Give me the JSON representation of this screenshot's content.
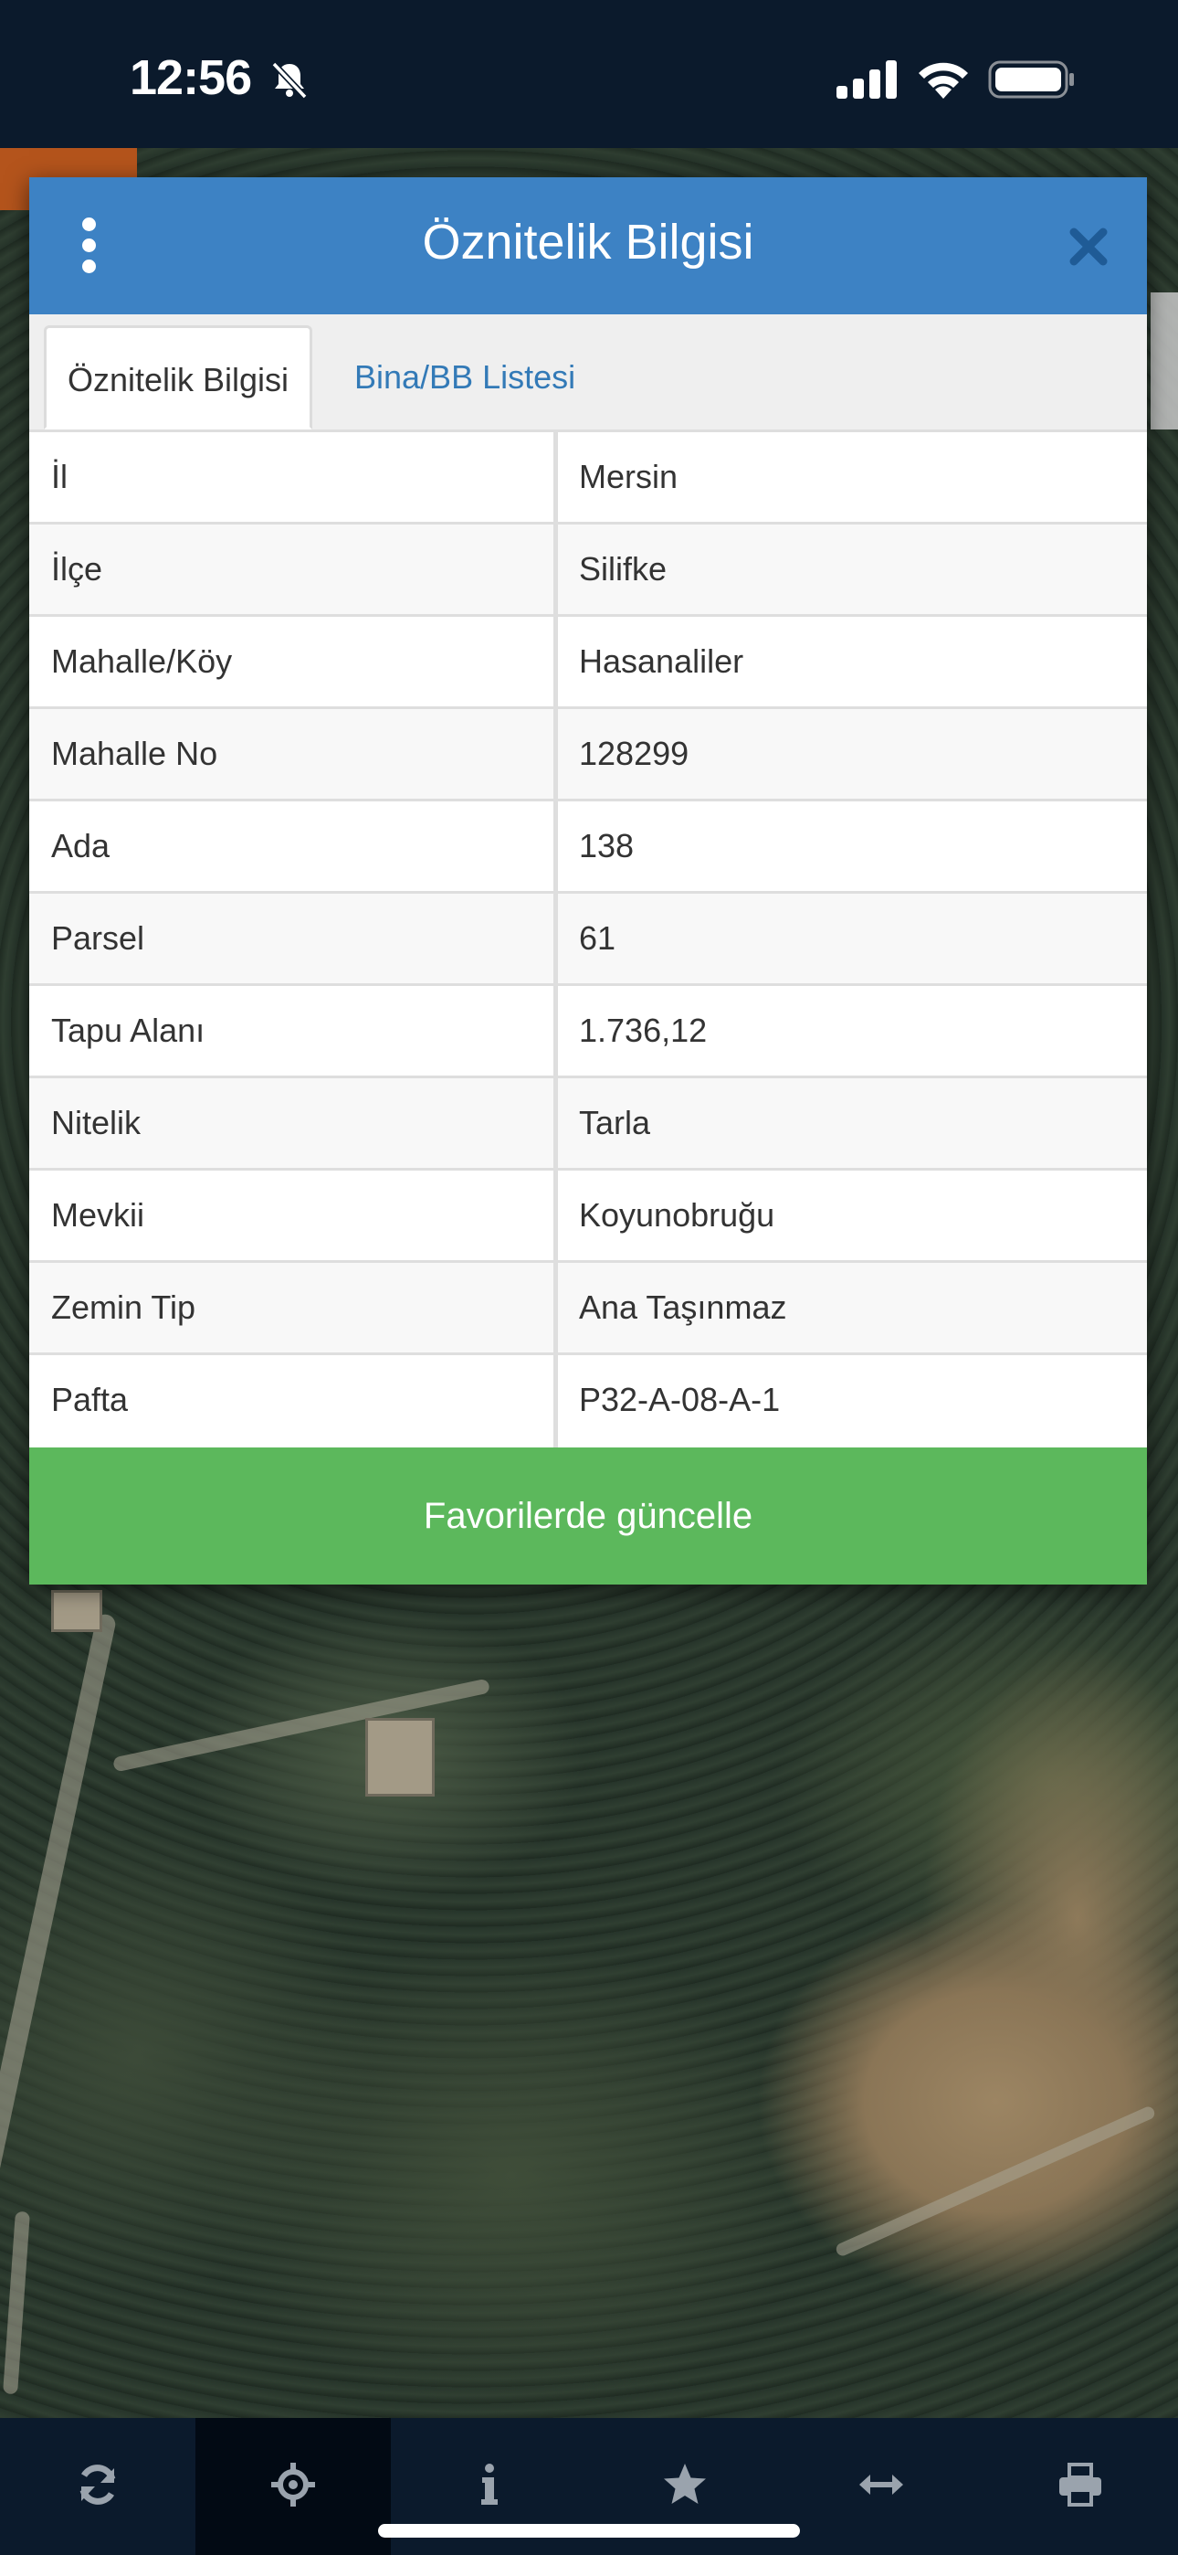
{
  "status_bar": {
    "time": "12:56",
    "icons": [
      "bell-slash-icon",
      "cellular-signal-icon",
      "wifi-icon",
      "battery-icon"
    ]
  },
  "modal": {
    "title": "Öznitelik Bilgisi",
    "menu_icon": "kebab-menu-icon",
    "close_icon": "close-icon",
    "tabs": [
      {
        "label": "Öznitelik Bilgisi",
        "active": true
      },
      {
        "label": "Bina/BB Listesi",
        "active": false
      }
    ],
    "rows": [
      {
        "label": "İl",
        "value": "Mersin"
      },
      {
        "label": "İlçe",
        "value": "Silifke"
      },
      {
        "label": "Mahalle/Köy",
        "value": "Hasanaliler"
      },
      {
        "label": "Mahalle No",
        "value": "128299"
      },
      {
        "label": "Ada",
        "value": "138"
      },
      {
        "label": "Parsel",
        "value": "61"
      },
      {
        "label": "Tapu Alanı",
        "value": "1.736,12"
      },
      {
        "label": "Nitelik",
        "value": "Tarla"
      },
      {
        "label": "Mevkii",
        "value": "Koyunobruğu"
      },
      {
        "label": "Zemin Tip",
        "value": "Ana Taşınmaz"
      },
      {
        "label": "Pafta",
        "value": "P32-A-08-A-1"
      }
    ],
    "update_button": "Favorilerde güncelle"
  },
  "toolbar": {
    "items": [
      {
        "icon": "refresh-icon",
        "active": false
      },
      {
        "icon": "crosshair-locate-icon",
        "active": true
      },
      {
        "icon": "info-icon",
        "active": false
      },
      {
        "icon": "star-icon",
        "active": false
      },
      {
        "icon": "measure-arrows-icon",
        "active": false
      },
      {
        "icon": "print-icon",
        "active": false
      }
    ]
  },
  "colors": {
    "header_blue": "#3d82c4",
    "button_green": "#5cb85c",
    "tab_link_blue": "#337ab7",
    "toolbar_navy": "#0b1a2c"
  }
}
